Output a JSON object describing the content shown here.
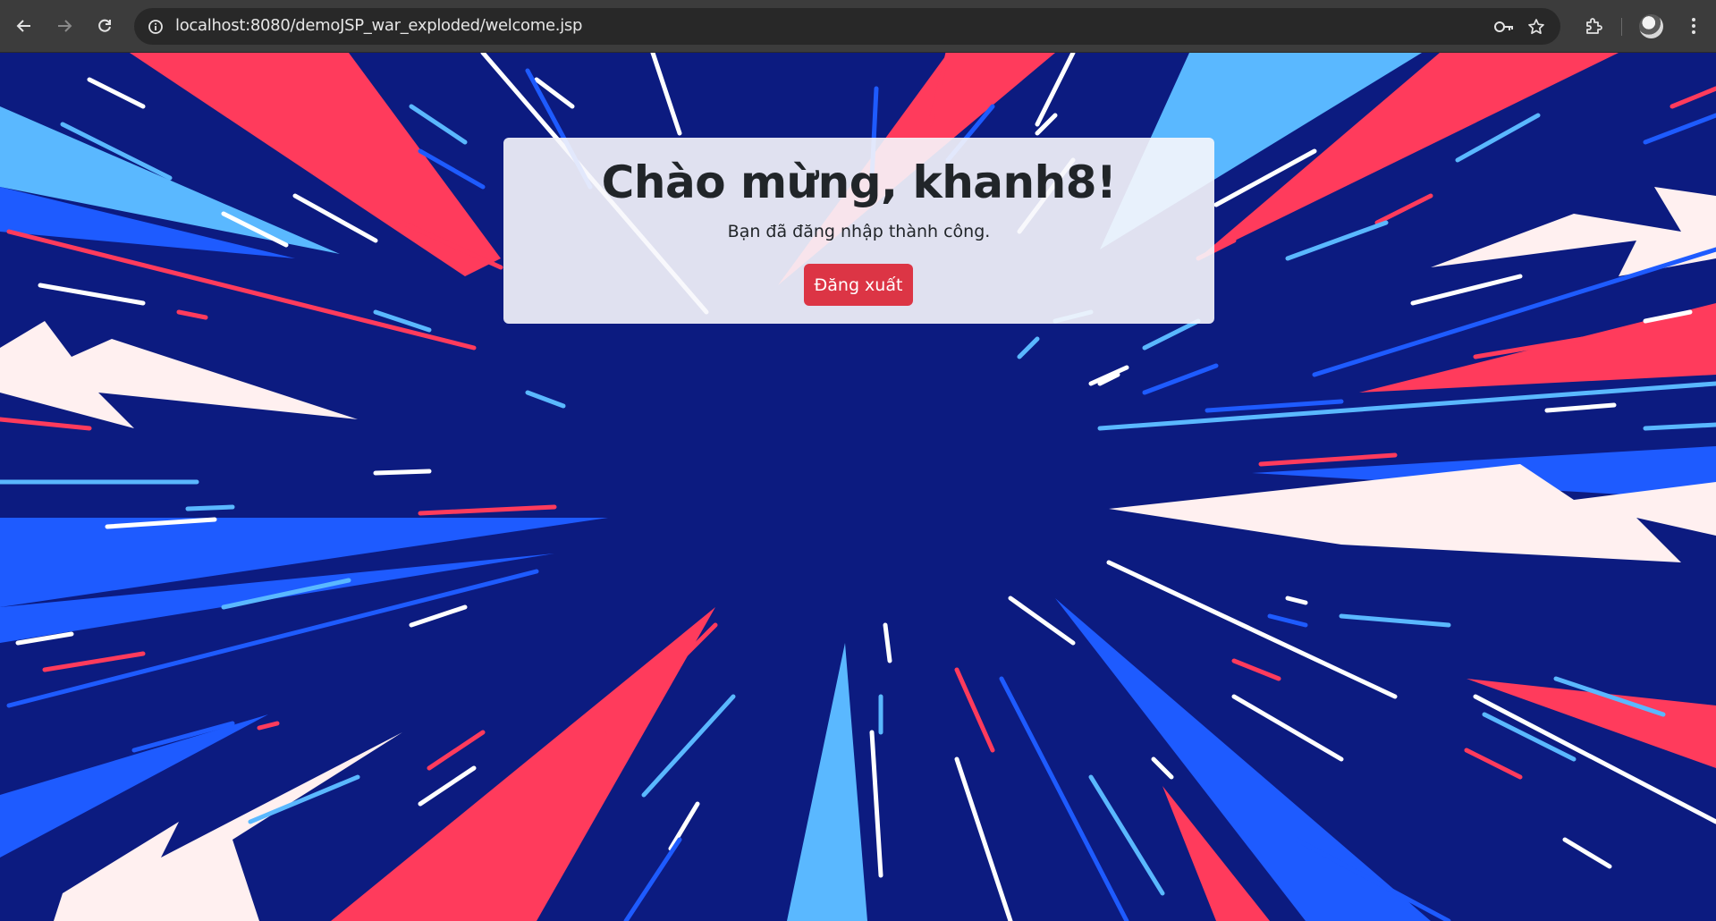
{
  "browser": {
    "url": "localhost:8080/demoJSP_war_exploded/welcome.jsp",
    "icons": [
      "back-icon",
      "forward-icon",
      "reload-icon",
      "site-info-icon",
      "password-key-icon",
      "bookmark-star-icon",
      "extensions-icon",
      "profile-avatar",
      "more-menu-icon"
    ]
  },
  "page": {
    "heading": "Chào mừng, khanh8!",
    "message": "Bạn đã đăng nhập thành công.",
    "logout_label": "Đăng xuất"
  },
  "colors": {
    "background": "#0c1b80",
    "logout_button": "#dc3545",
    "ray_red": "#ff3b5c",
    "ray_blue": "#1e5bff",
    "ray_light_blue": "#5ab8ff",
    "ray_white": "#fff0f0"
  }
}
